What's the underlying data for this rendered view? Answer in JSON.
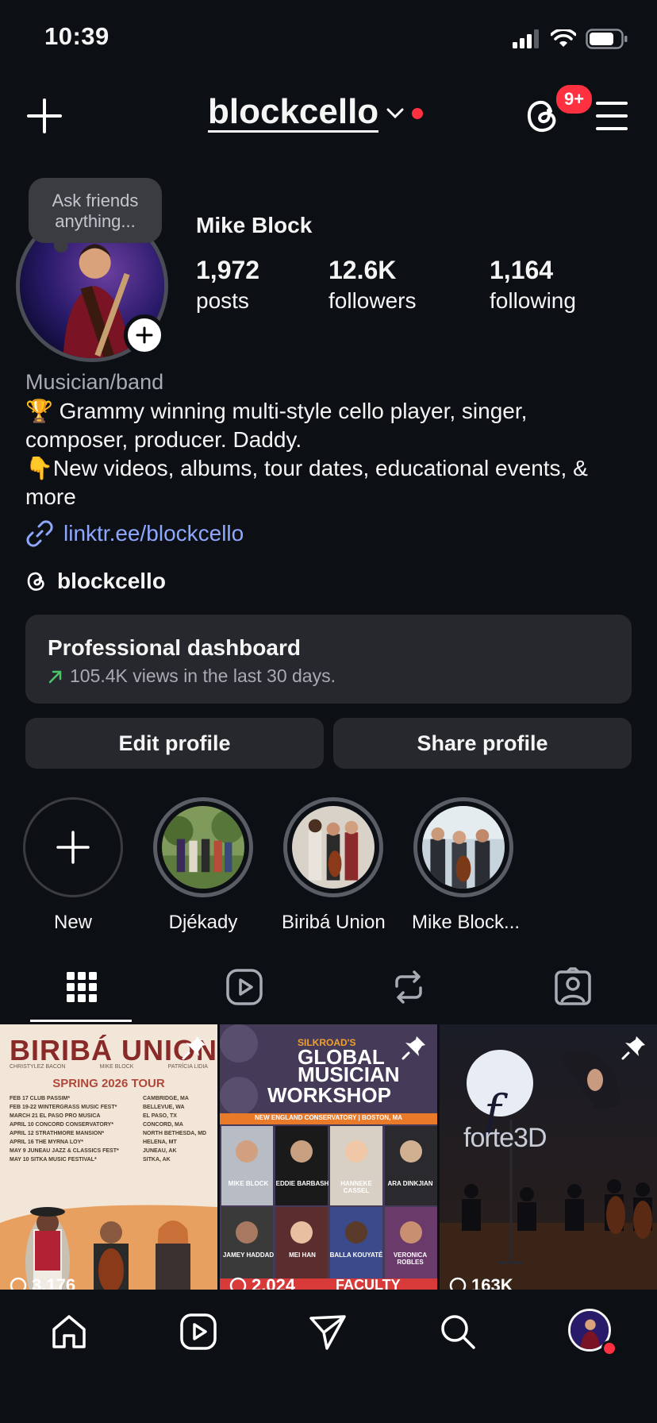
{
  "status_bar": {
    "time": "10:39"
  },
  "header": {
    "username": "blockcello",
    "notif_badge": "9+"
  },
  "profile": {
    "note": "Ask friends anything...",
    "display_name": "Mike Block",
    "stats": [
      {
        "value": "1,972",
        "label": "posts"
      },
      {
        "value": "12.6K",
        "label": "followers"
      },
      {
        "value": "1,164",
        "label": "following"
      }
    ],
    "category": "Musician/band",
    "bio_line1": "🏆 Grammy winning multi-style cello player, singer, composer, producer. Daddy.",
    "bio_line2": "👇New videos, albums, tour dates, educational events, & more",
    "link": "linktr.ee/blockcello",
    "threads_handle": "blockcello"
  },
  "dashboard": {
    "title": "Professional dashboard",
    "subtitle": "105.4K views in the last 30 days."
  },
  "buttons": {
    "edit": "Edit profile",
    "share": "Share profile"
  },
  "highlights": [
    {
      "label": "New"
    },
    {
      "label": "Djékady"
    },
    {
      "label": "Biribá Union"
    },
    {
      "label": "Mike Block..."
    }
  ],
  "posts": [
    {
      "title": "BIRIBÁ UNION",
      "names": [
        "CHRISTYLEZ BACON",
        "MIKE BLOCK",
        "PATRÍCIA LIDIA"
      ],
      "subtitle": "SPRING 2026 TOUR",
      "tour_left": [
        "FEB 17   CLUB PASSIM*",
        "FEB 19-22   WINTERGRASS MUSIC FEST*",
        "MARCH 21   EL PASO PRO MUSICA",
        "APRIL 10   CONCORD CONSERVATORY*",
        "APRIL 12   STRATHMORE MANSION*",
        "APRIL 16   THE MYRNA LOY*",
        "MAY 9   JUNEAU JAZZ & CLASSICS FEST*",
        "MAY 10   SITKA MUSIC FESTIVAL*"
      ],
      "tour_right": [
        "CAMBRIDGE, MA",
        "BELLEVUE, WA",
        "EL PASO, TX",
        "CONCORD, MA",
        "NORTH BETHESDA, MD",
        "HELENA, MT",
        "JUNEAU, AK",
        "SITKA, AK"
      ],
      "views": "3,176"
    },
    {
      "kicker": "SILKROAD'S",
      "title1": "GLOBAL",
      "title2": "MUSICIAN",
      "title3": "WORKSHOP",
      "venue": "NEW ENGLAND CONSERVATORY | BOSTON, MA",
      "faculty": [
        "MIKE BLOCK",
        "EDDIE BARBASH",
        "HANNEKE CASSEL",
        "ARA DINKJIAN",
        "JAMEY HADDAD",
        "MEI HAN",
        "BALLA KOUYATÉ",
        "VERONICA ROBLES"
      ],
      "views": "2,024",
      "footer": "FACULTY"
    },
    {
      "logo": "forte3D",
      "views": "163K"
    }
  ],
  "colors": {
    "background": "#0c0f14",
    "accent_red": "#ff3040",
    "link": "#8fa8ff",
    "card": "#26282d"
  }
}
